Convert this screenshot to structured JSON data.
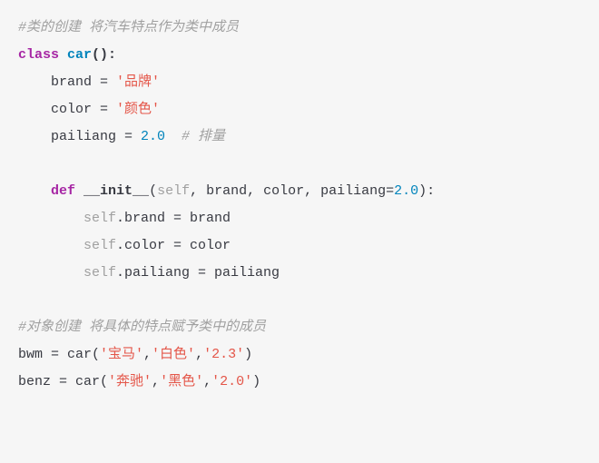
{
  "c1": "#类的创建 将汽车特点作为类中成员",
  "kw_class": "class",
  "cls": "car",
  "op_paren_colon": "():",
  "l_brand": "    brand = ",
  "v_brand": "'品牌'",
  "l_color": "    color = ",
  "v_color": "'颜色'",
  "l_pailiang": "    pailiang = ",
  "v_pailiang": "2.0",
  "c_pailiang": "  # 排量",
  "kw_def": "def",
  "fn_init": "__init__",
  "sig_open": "(",
  "p_self": "self",
  "sig_rest": ", brand, color, pailiang=",
  "default_pailiang": "2.0",
  "sig_close": "):",
  "b1a": "        ",
  "b_self": "self",
  "b1c": ".brand = brand",
  "b2c": ".color = color",
  "b3c": ".pailiang = pailiang",
  "c2": "#对象创建 将具体的特点赋予类中的成员",
  "call1_pre": "bwm = car(",
  "call1_a1": "'宝马'",
  "call1_sep1": ",",
  "call1_a2": "'白色'",
  "call1_a3": "'2.3'",
  "call1_close": ")",
  "call2_pre": "benz = car(",
  "call2_a1": "'奔驰'",
  "call2_a2": "'黑色'",
  "call2_a3": "'2.0'",
  "call2_close": ")",
  "def_indent": "    "
}
